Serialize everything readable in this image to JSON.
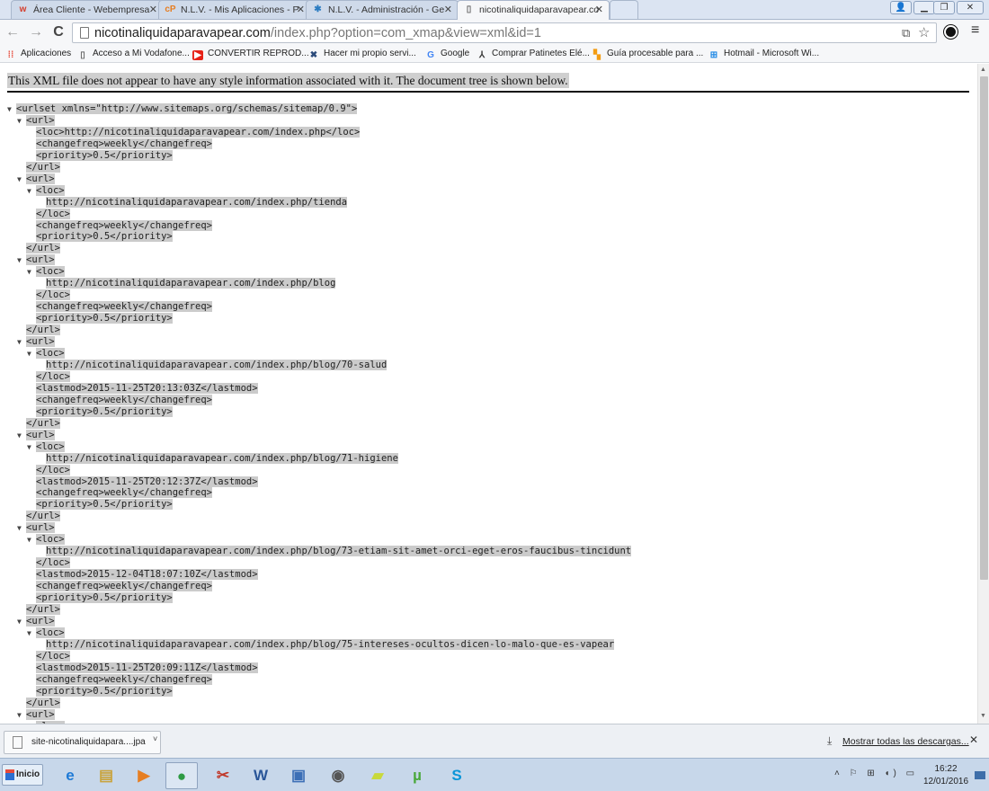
{
  "browser": {
    "tabs": [
      {
        "title": "Área Cliente - Webempresa",
        "icon": "webempresa-w-icon",
        "color": "#d43c2a"
      },
      {
        "title": "N.L.V. - Mis Aplicaciones - P",
        "icon": "cp-icon",
        "color": "#e67e22"
      },
      {
        "title": "N.L.V. - Administración - Ge",
        "icon": "joomla-icon",
        "color": "#2c7cc1"
      },
      {
        "title": "nicotinaliquidaparavapear.co",
        "icon": "page-icon",
        "color": "#666666"
      }
    ],
    "address": {
      "host": "nicotinaliquidaparavapear.com",
      "path": "/index.php?option=com_xmap&view=xml&id=1"
    },
    "bookmarks": [
      {
        "label": "Aplicaciones",
        "icon": "apps-grid-icon",
        "color": "#e74c3c"
      },
      {
        "label": "Acceso a Mi Vodafone...",
        "icon": "page-icon",
        "color": "#666666"
      },
      {
        "label": "CONVERTIR REPROD...",
        "icon": "youtube-icon",
        "color": "#e62117"
      },
      {
        "label": "Hacer mi propio servi...",
        "icon": "tools-icon",
        "color": "#2b4a7a"
      },
      {
        "label": "Google",
        "icon": "google-g-icon",
        "color": "#4285f4"
      },
      {
        "label": "Comprar Patinetes Elé...",
        "icon": "scooter-icon",
        "color": "#333333"
      },
      {
        "label": "Guía procesable para ...",
        "icon": "blocks-icon",
        "color": "#f39c12"
      },
      {
        "label": "Hotmail - Microsoft Wi...",
        "icon": "windows-icon",
        "color": "#1e88e5"
      }
    ]
  },
  "xml_viewer": {
    "header": "This XML file does not appear to have any style information associated with it. The document tree is shown below.",
    "lines": [
      {
        "arrow": "▼",
        "indent": 0,
        "text": "<urlset xmlns=\"http://www.sitemaps.org/schemas/sitemap/0.9\">"
      },
      {
        "arrow": "▼",
        "indent": 1,
        "text": "<url>"
      },
      {
        "arrow": "",
        "indent": 2,
        "text": "<loc>http://nicotinaliquidaparavapear.com/index.php</loc>"
      },
      {
        "arrow": "",
        "indent": 2,
        "text": "<changefreq>weekly</changefreq>"
      },
      {
        "arrow": "",
        "indent": 2,
        "text": "<priority>0.5</priority>"
      },
      {
        "arrow": "",
        "indent": 1,
        "text": "</url>"
      },
      {
        "arrow": "▼",
        "indent": 1,
        "text": "<url>"
      },
      {
        "arrow": "▼",
        "indent": 2,
        "text": "<loc>"
      },
      {
        "arrow": "",
        "indent": 3,
        "text": "http://nicotinaliquidaparavapear.com/index.php/tienda"
      },
      {
        "arrow": "",
        "indent": 2,
        "text": "</loc>"
      },
      {
        "arrow": "",
        "indent": 2,
        "text": "<changefreq>weekly</changefreq>"
      },
      {
        "arrow": "",
        "indent": 2,
        "text": "<priority>0.5</priority>"
      },
      {
        "arrow": "",
        "indent": 1,
        "text": "</url>"
      },
      {
        "arrow": "▼",
        "indent": 1,
        "text": "<url>"
      },
      {
        "arrow": "▼",
        "indent": 2,
        "text": "<loc>"
      },
      {
        "arrow": "",
        "indent": 3,
        "text": "http://nicotinaliquidaparavapear.com/index.php/blog"
      },
      {
        "arrow": "",
        "indent": 2,
        "text": "</loc>"
      },
      {
        "arrow": "",
        "indent": 2,
        "text": "<changefreq>weekly</changefreq>"
      },
      {
        "arrow": "",
        "indent": 2,
        "text": "<priority>0.5</priority>"
      },
      {
        "arrow": "",
        "indent": 1,
        "text": "</url>"
      },
      {
        "arrow": "▼",
        "indent": 1,
        "text": "<url>"
      },
      {
        "arrow": "▼",
        "indent": 2,
        "text": "<loc>"
      },
      {
        "arrow": "",
        "indent": 3,
        "text": "http://nicotinaliquidaparavapear.com/index.php/blog/70-salud"
      },
      {
        "arrow": "",
        "indent": 2,
        "text": "</loc>"
      },
      {
        "arrow": "",
        "indent": 2,
        "text": "<lastmod>2015-11-25T20:13:03Z</lastmod>"
      },
      {
        "arrow": "",
        "indent": 2,
        "text": "<changefreq>weekly</changefreq>"
      },
      {
        "arrow": "",
        "indent": 2,
        "text": "<priority>0.5</priority>"
      },
      {
        "arrow": "",
        "indent": 1,
        "text": "</url>"
      },
      {
        "arrow": "▼",
        "indent": 1,
        "text": "<url>"
      },
      {
        "arrow": "▼",
        "indent": 2,
        "text": "<loc>"
      },
      {
        "arrow": "",
        "indent": 3,
        "text": "http://nicotinaliquidaparavapear.com/index.php/blog/71-higiene"
      },
      {
        "arrow": "",
        "indent": 2,
        "text": "</loc>"
      },
      {
        "arrow": "",
        "indent": 2,
        "text": "<lastmod>2015-11-25T20:12:37Z</lastmod>"
      },
      {
        "arrow": "",
        "indent": 2,
        "text": "<changefreq>weekly</changefreq>"
      },
      {
        "arrow": "",
        "indent": 2,
        "text": "<priority>0.5</priority>"
      },
      {
        "arrow": "",
        "indent": 1,
        "text": "</url>"
      },
      {
        "arrow": "▼",
        "indent": 1,
        "text": "<url>"
      },
      {
        "arrow": "▼",
        "indent": 2,
        "text": "<loc>"
      },
      {
        "arrow": "",
        "indent": 3,
        "text": "http://nicotinaliquidaparavapear.com/index.php/blog/73-etiam-sit-amet-orci-eget-eros-faucibus-tincidunt"
      },
      {
        "arrow": "",
        "indent": 2,
        "text": "</loc>"
      },
      {
        "arrow": "",
        "indent": 2,
        "text": "<lastmod>2015-12-04T18:07:10Z</lastmod>"
      },
      {
        "arrow": "",
        "indent": 2,
        "text": "<changefreq>weekly</changefreq>"
      },
      {
        "arrow": "",
        "indent": 2,
        "text": "<priority>0.5</priority>"
      },
      {
        "arrow": "",
        "indent": 1,
        "text": "</url>"
      },
      {
        "arrow": "▼",
        "indent": 1,
        "text": "<url>"
      },
      {
        "arrow": "▼",
        "indent": 2,
        "text": "<loc>"
      },
      {
        "arrow": "",
        "indent": 3,
        "text": "http://nicotinaliquidaparavapear.com/index.php/blog/75-intereses-ocultos-dicen-lo-malo-que-es-vapear"
      },
      {
        "arrow": "",
        "indent": 2,
        "text": "</loc>"
      },
      {
        "arrow": "",
        "indent": 2,
        "text": "<lastmod>2015-11-25T20:09:11Z</lastmod>"
      },
      {
        "arrow": "",
        "indent": 2,
        "text": "<changefreq>weekly</changefreq>"
      },
      {
        "arrow": "",
        "indent": 2,
        "text": "<priority>0.5</priority>"
      },
      {
        "arrow": "",
        "indent": 1,
        "text": "</url>"
      },
      {
        "arrow": "▼",
        "indent": 1,
        "text": "<url>"
      },
      {
        "arrow": "▼",
        "indent": 2,
        "text": "<loc>"
      }
    ]
  },
  "downloads": {
    "file": "site-nicotinaliquidapara....jpa",
    "show_all": "Mostrar todas las descargas..."
  },
  "taskbar": {
    "start_label": "Inicio",
    "apps": [
      {
        "name": "internet-explorer-icon",
        "glyph": "e",
        "color": "#1e7ad6",
        "pinned": false
      },
      {
        "name": "file-explorer-icon",
        "glyph": "▤",
        "color": "#c9a33b",
        "pinned": false
      },
      {
        "name": "media-player-icon",
        "glyph": "▶",
        "color": "#e67e22",
        "pinned": false
      },
      {
        "name": "chrome-icon",
        "glyph": "●",
        "color": "#2e9b44",
        "pinned": true
      },
      {
        "name": "snipping-tool-icon",
        "glyph": "✂",
        "color": "#c0392b",
        "pinned": false
      },
      {
        "name": "word-icon",
        "glyph": "W",
        "color": "#2a5699",
        "pinned": false
      },
      {
        "name": "computer-icon",
        "glyph": "▣",
        "color": "#3c6fb6",
        "pinned": false
      },
      {
        "name": "camera-icon",
        "glyph": "◉",
        "color": "#555555",
        "pinned": false
      },
      {
        "name": "folder-icon",
        "glyph": "▰",
        "color": "#c8d93b",
        "pinned": false
      },
      {
        "name": "utorrent-icon",
        "glyph": "µ",
        "color": "#4aa83c",
        "pinned": false
      },
      {
        "name": "skype-icon",
        "glyph": "S",
        "color": "#0a95d8",
        "pinned": false
      }
    ],
    "clock_time": "16:22",
    "clock_date": "12/01/2016"
  }
}
